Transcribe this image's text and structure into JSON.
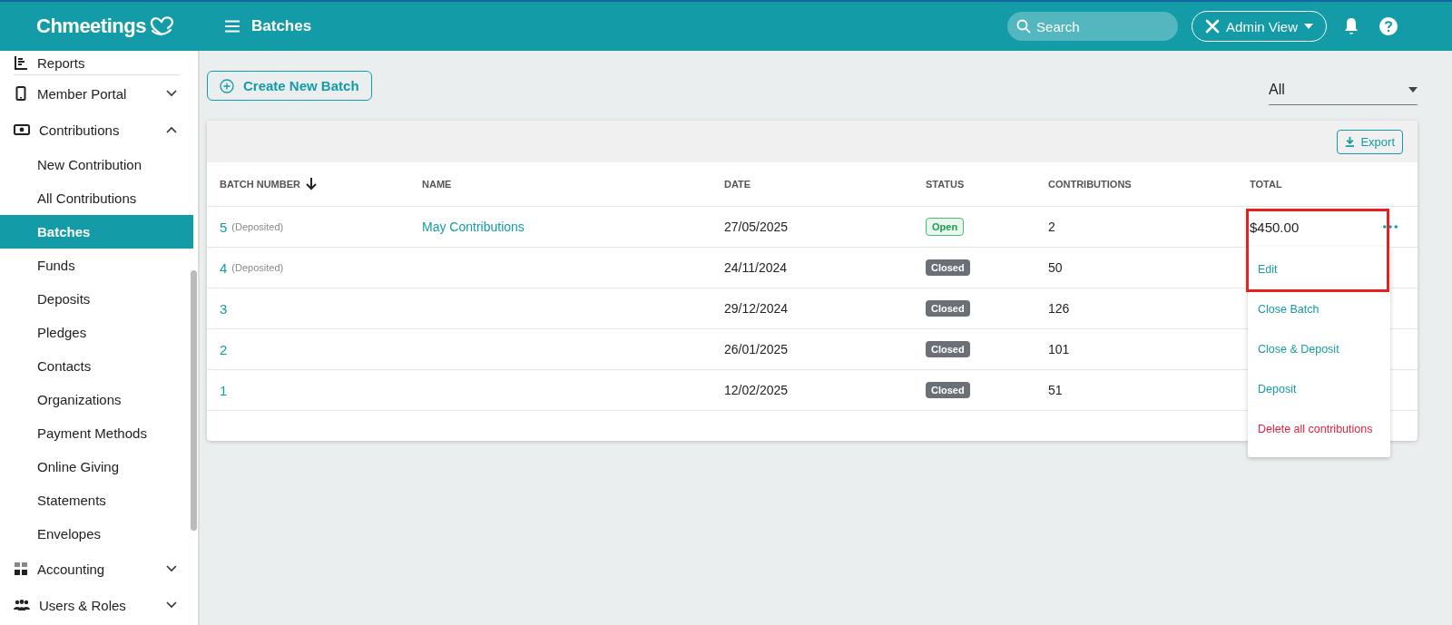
{
  "header": {
    "logo": "Chmeetings",
    "title": "Batches",
    "search": {
      "placeholder": "Search"
    },
    "view_button": "Admin View"
  },
  "sidebar": {
    "items": [
      {
        "label": "Reports",
        "kind": "link"
      },
      {
        "label": "Member Portal",
        "kind": "group",
        "expanded": false
      },
      {
        "label": "Contributions",
        "kind": "group",
        "expanded": true,
        "children": [
          {
            "label": "New Contribution",
            "selected": false
          },
          {
            "label": "All Contributions",
            "selected": false
          },
          {
            "label": "Batches",
            "selected": true
          },
          {
            "label": "Funds",
            "selected": false
          },
          {
            "label": "Deposits",
            "selected": false
          },
          {
            "label": "Pledges",
            "selected": false
          },
          {
            "label": "Contacts",
            "selected": false
          },
          {
            "label": "Organizations",
            "selected": false
          },
          {
            "label": "Payment Methods",
            "selected": false
          },
          {
            "label": "Online Giving",
            "selected": false
          },
          {
            "label": "Statements",
            "selected": false
          },
          {
            "label": "Envelopes",
            "selected": false
          }
        ]
      },
      {
        "label": "Accounting",
        "kind": "group",
        "expanded": false
      },
      {
        "label": "Users & Roles",
        "kind": "group",
        "expanded": false
      }
    ]
  },
  "create_button": "Create New Batch",
  "filter": {
    "value": "All"
  },
  "export_button": "Export",
  "table": {
    "columns": [
      "BATCH NUMBER",
      "NAME",
      "DATE",
      "STATUS",
      "CONTRIBUTIONS",
      "TOTAL"
    ],
    "rows": [
      {
        "number": "5",
        "note": "(Deposited)",
        "name": "May Contributions",
        "date": "27/05/2025",
        "status": "Open",
        "kind": "open",
        "contributions": "2",
        "total": "$450.00",
        "menu_open": true
      },
      {
        "number": "4",
        "note": "(Deposited)",
        "date": "24/11/2024",
        "status": "Closed",
        "kind": "closed",
        "contributions": "50",
        "menu_open": false
      },
      {
        "number": "3",
        "date": "29/12/2024",
        "status": "Closed",
        "kind": "closed",
        "contributions": "126",
        "menu_open": false
      },
      {
        "number": "2",
        "date": "26/01/2025",
        "status": "Closed",
        "kind": "closed",
        "contributions": "101",
        "menu_open": false
      },
      {
        "number": "1",
        "date": "12/02/2025",
        "status": "Closed",
        "kind": "closed",
        "contributions": "51",
        "menu_open": false
      }
    ]
  },
  "row_menu": {
    "items": [
      {
        "label": "Edit",
        "kind": "normal"
      },
      {
        "label": "Close Batch",
        "kind": "normal"
      },
      {
        "label": "Close & Deposit",
        "kind": "normal"
      },
      {
        "label": "Deposit",
        "kind": "normal"
      },
      {
        "label": "Delete all contributions",
        "kind": "danger"
      }
    ]
  },
  "annotation_highlight": true
}
